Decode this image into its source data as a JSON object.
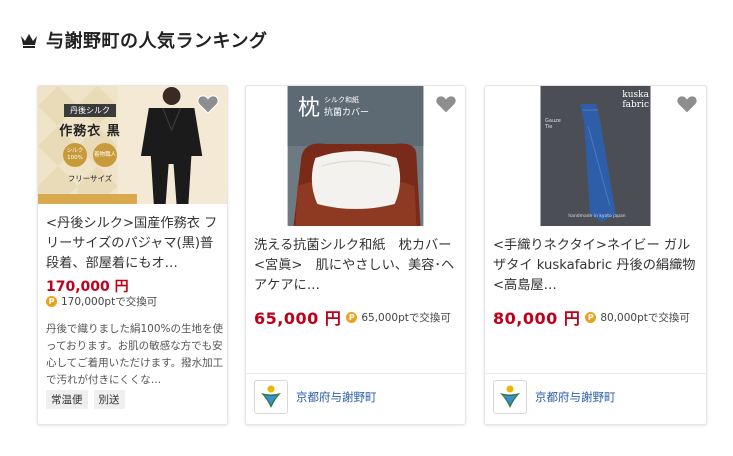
{
  "section": {
    "title": "与謝野町の人気ランキング",
    "icon": "crown-icon"
  },
  "colors": {
    "price": "#c0001a",
    "point_badge": "#e8a21c",
    "link": "#2b5ea7"
  },
  "products": [
    {
      "thumb_text": {
        "band": "丹後シルク",
        "main": "作務衣 黒",
        "badge1": "シルク100%",
        "badge2": "着物職人",
        "size": "フリーサイズ"
      },
      "name": "<丹後シルク>国産作務衣 フリーサイズのパジャマ(黒)普段着、部屋着にもオ…",
      "price": "170,000 円",
      "points": "170,000ptで交換可",
      "description": "丹後で織りました絹100%の生地を使っております。お肌の敏感な方でも安心してご着用いただけます。撥水加工で汚れが付きにくくな…",
      "tags": [
        "常温便",
        "別送"
      ]
    },
    {
      "thumb_text": {
        "kanji": "枕",
        "sub1": "シルク和紙",
        "sub2": "抗菌カバー"
      },
      "name": "洗える抗菌シルク和紙　枕カバー<宮眞>　肌にやさしい、美容･ヘアケアに…",
      "price": "65,000 円",
      "points": "65,000ptで交換可",
      "municipality": "京都府与謝野町"
    },
    {
      "thumb_text": {
        "brand1": "kuska",
        "brand2": "fabric",
        "label1": "Gauze",
        "label2": "Tie",
        "footer": "handmade in kyoto japan"
      },
      "name": "<手織りネクタイ>ネイビー ガルザタイ kuskafabric 丹後の絹織物<高島屋…",
      "price": "80,000 円",
      "points": "80,000ptで交換可",
      "municipality": "京都府与謝野町"
    }
  ]
}
